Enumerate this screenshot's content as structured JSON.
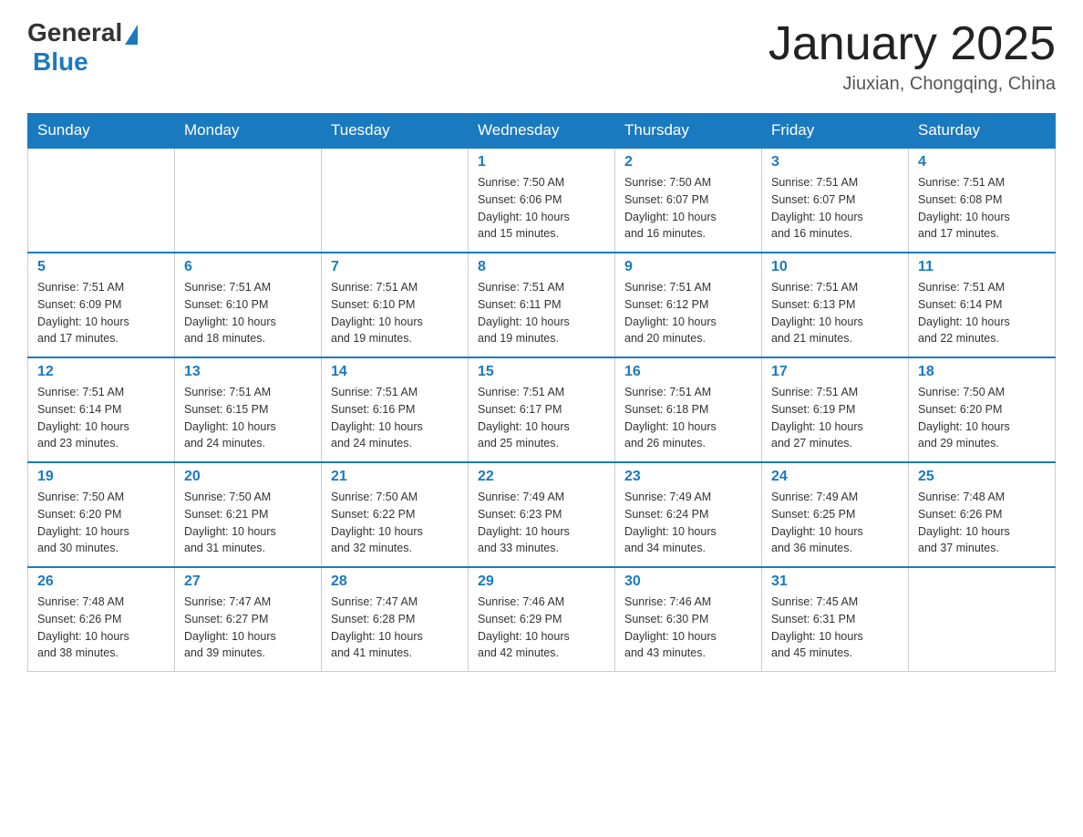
{
  "logo": {
    "general": "General",
    "blue": "Blue",
    "tagline": "Blue"
  },
  "header": {
    "month": "January 2025",
    "location": "Jiuxian, Chongqing, China"
  },
  "days_of_week": [
    "Sunday",
    "Monday",
    "Tuesday",
    "Wednesday",
    "Thursday",
    "Friday",
    "Saturday"
  ],
  "weeks": [
    [
      {
        "day": "",
        "info": ""
      },
      {
        "day": "",
        "info": ""
      },
      {
        "day": "",
        "info": ""
      },
      {
        "day": "1",
        "info": "Sunrise: 7:50 AM\nSunset: 6:06 PM\nDaylight: 10 hours\nand 15 minutes."
      },
      {
        "day": "2",
        "info": "Sunrise: 7:50 AM\nSunset: 6:07 PM\nDaylight: 10 hours\nand 16 minutes."
      },
      {
        "day": "3",
        "info": "Sunrise: 7:51 AM\nSunset: 6:07 PM\nDaylight: 10 hours\nand 16 minutes."
      },
      {
        "day": "4",
        "info": "Sunrise: 7:51 AM\nSunset: 6:08 PM\nDaylight: 10 hours\nand 17 minutes."
      }
    ],
    [
      {
        "day": "5",
        "info": "Sunrise: 7:51 AM\nSunset: 6:09 PM\nDaylight: 10 hours\nand 17 minutes."
      },
      {
        "day": "6",
        "info": "Sunrise: 7:51 AM\nSunset: 6:10 PM\nDaylight: 10 hours\nand 18 minutes."
      },
      {
        "day": "7",
        "info": "Sunrise: 7:51 AM\nSunset: 6:10 PM\nDaylight: 10 hours\nand 19 minutes."
      },
      {
        "day": "8",
        "info": "Sunrise: 7:51 AM\nSunset: 6:11 PM\nDaylight: 10 hours\nand 19 minutes."
      },
      {
        "day": "9",
        "info": "Sunrise: 7:51 AM\nSunset: 6:12 PM\nDaylight: 10 hours\nand 20 minutes."
      },
      {
        "day": "10",
        "info": "Sunrise: 7:51 AM\nSunset: 6:13 PM\nDaylight: 10 hours\nand 21 minutes."
      },
      {
        "day": "11",
        "info": "Sunrise: 7:51 AM\nSunset: 6:14 PM\nDaylight: 10 hours\nand 22 minutes."
      }
    ],
    [
      {
        "day": "12",
        "info": "Sunrise: 7:51 AM\nSunset: 6:14 PM\nDaylight: 10 hours\nand 23 minutes."
      },
      {
        "day": "13",
        "info": "Sunrise: 7:51 AM\nSunset: 6:15 PM\nDaylight: 10 hours\nand 24 minutes."
      },
      {
        "day": "14",
        "info": "Sunrise: 7:51 AM\nSunset: 6:16 PM\nDaylight: 10 hours\nand 24 minutes."
      },
      {
        "day": "15",
        "info": "Sunrise: 7:51 AM\nSunset: 6:17 PM\nDaylight: 10 hours\nand 25 minutes."
      },
      {
        "day": "16",
        "info": "Sunrise: 7:51 AM\nSunset: 6:18 PM\nDaylight: 10 hours\nand 26 minutes."
      },
      {
        "day": "17",
        "info": "Sunrise: 7:51 AM\nSunset: 6:19 PM\nDaylight: 10 hours\nand 27 minutes."
      },
      {
        "day": "18",
        "info": "Sunrise: 7:50 AM\nSunset: 6:20 PM\nDaylight: 10 hours\nand 29 minutes."
      }
    ],
    [
      {
        "day": "19",
        "info": "Sunrise: 7:50 AM\nSunset: 6:20 PM\nDaylight: 10 hours\nand 30 minutes."
      },
      {
        "day": "20",
        "info": "Sunrise: 7:50 AM\nSunset: 6:21 PM\nDaylight: 10 hours\nand 31 minutes."
      },
      {
        "day": "21",
        "info": "Sunrise: 7:50 AM\nSunset: 6:22 PM\nDaylight: 10 hours\nand 32 minutes."
      },
      {
        "day": "22",
        "info": "Sunrise: 7:49 AM\nSunset: 6:23 PM\nDaylight: 10 hours\nand 33 minutes."
      },
      {
        "day": "23",
        "info": "Sunrise: 7:49 AM\nSunset: 6:24 PM\nDaylight: 10 hours\nand 34 minutes."
      },
      {
        "day": "24",
        "info": "Sunrise: 7:49 AM\nSunset: 6:25 PM\nDaylight: 10 hours\nand 36 minutes."
      },
      {
        "day": "25",
        "info": "Sunrise: 7:48 AM\nSunset: 6:26 PM\nDaylight: 10 hours\nand 37 minutes."
      }
    ],
    [
      {
        "day": "26",
        "info": "Sunrise: 7:48 AM\nSunset: 6:26 PM\nDaylight: 10 hours\nand 38 minutes."
      },
      {
        "day": "27",
        "info": "Sunrise: 7:47 AM\nSunset: 6:27 PM\nDaylight: 10 hours\nand 39 minutes."
      },
      {
        "day": "28",
        "info": "Sunrise: 7:47 AM\nSunset: 6:28 PM\nDaylight: 10 hours\nand 41 minutes."
      },
      {
        "day": "29",
        "info": "Sunrise: 7:46 AM\nSunset: 6:29 PM\nDaylight: 10 hours\nand 42 minutes."
      },
      {
        "day": "30",
        "info": "Sunrise: 7:46 AM\nSunset: 6:30 PM\nDaylight: 10 hours\nand 43 minutes."
      },
      {
        "day": "31",
        "info": "Sunrise: 7:45 AM\nSunset: 6:31 PM\nDaylight: 10 hours\nand 45 minutes."
      },
      {
        "day": "",
        "info": ""
      }
    ]
  ]
}
